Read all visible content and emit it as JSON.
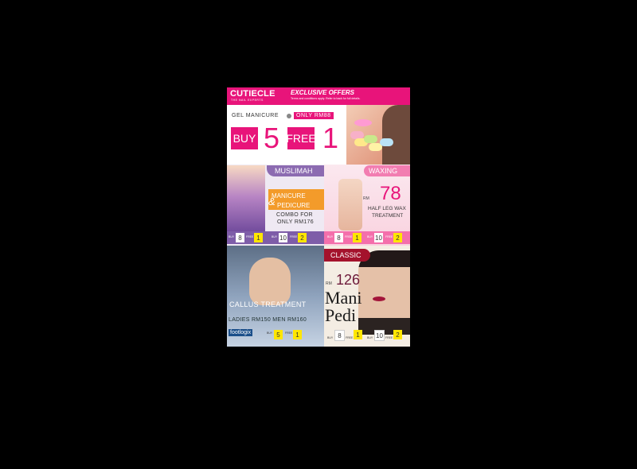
{
  "header": {
    "logo": "CUTIECLE",
    "tagline": "THE NAIL EXPERTS",
    "title": "EXCLUSIVE OFFERS",
    "terms": "Terms and conditions apply. Refer to back for full details."
  },
  "gel": {
    "label": "GEL MANICURE",
    "price": "ONLY RM88",
    "buy_label": "BUY",
    "buy_qty": "5",
    "free_label": "FREE",
    "free_qty": "1"
  },
  "muslimah": {
    "title": "MUSLIMAH",
    "combo_line_a": "MANICURE",
    "combo_amp": "&",
    "combo_line_b": "PEDICURE",
    "desc_1": "COMBO FOR",
    "desc_2": "ONLY RM176",
    "offers": [
      {
        "buy_label": "BUY",
        "buy": "8",
        "free_label": "FREE",
        "free": "1"
      },
      {
        "buy_label": "BUY",
        "buy": "10",
        "free_label": "FREE",
        "free": "2"
      }
    ]
  },
  "waxing": {
    "title": "WAXING",
    "currency": "RM",
    "price": "78",
    "desc_1": "HALF LEG WAX",
    "desc_2": "TREATMENT",
    "offers": [
      {
        "buy_label": "BUY",
        "buy": "8",
        "free_label": "FREE",
        "free": "1"
      },
      {
        "buy_label": "BUY",
        "buy": "10",
        "free_label": "FREE",
        "free": "2"
      }
    ]
  },
  "callus": {
    "title": "CALLUS TREATMENT",
    "prices": "LADIES RM150   MEN RM160",
    "brand": "footlogix",
    "offers": [
      {
        "buy_label": "BUY",
        "buy": "5",
        "free_label": "FREE",
        "free": "1"
      }
    ]
  },
  "classic": {
    "title": "CLASSIC",
    "currency": "RM",
    "price": "126",
    "word1": "Mani",
    "word2": "Pedi",
    "offers": [
      {
        "buy_label": "BUY",
        "buy": "8",
        "free_label": "FREE",
        "free": "1"
      },
      {
        "buy_label": "BUY",
        "buy": "10",
        "free_label": "FREE",
        "free": "2"
      }
    ]
  },
  "colors": {
    "brand_pink": "#e8147a",
    "muslimah_purple": "#8c6bb1",
    "waxing_pink": "#f27db1",
    "classic_red": "#a4122c",
    "offer_yellow": "#ffe600"
  }
}
